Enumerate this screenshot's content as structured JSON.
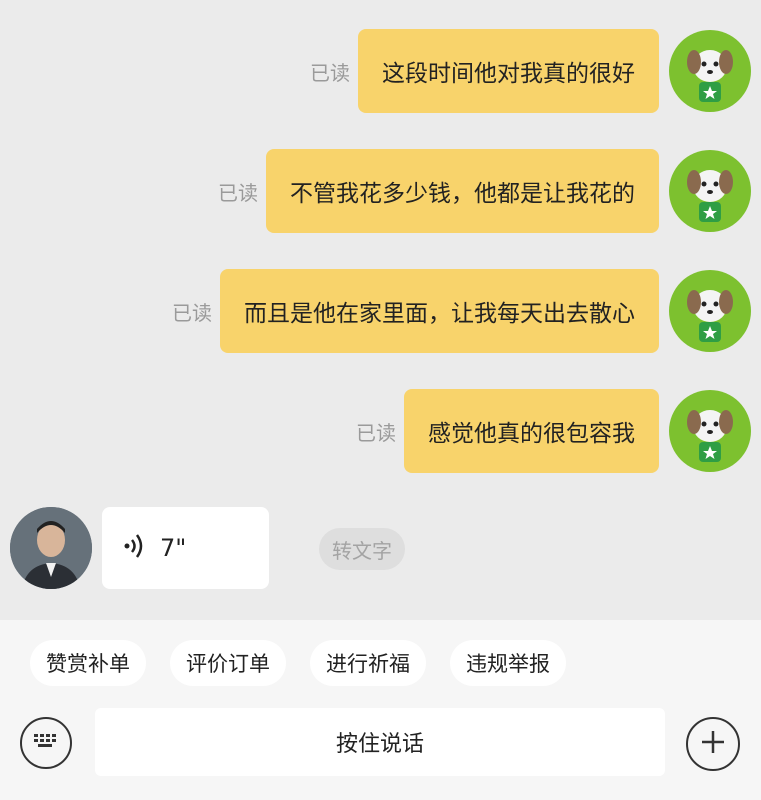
{
  "messages": [
    {
      "read": "已读",
      "text": "这段时间他对我真的很好"
    },
    {
      "read": "已读",
      "text": "不管我花多少钱，他都是让我花的"
    },
    {
      "read": "已读",
      "text": "而且是他在家里面，让我每天出去散心"
    },
    {
      "read": "已读",
      "text": "感觉他真的很包容我"
    }
  ],
  "voice": {
    "duration": "7\"",
    "convert_label": "转文字"
  },
  "quick_actions": [
    "赞赏补单",
    "评价订单",
    "进行祈福",
    "违规举报"
  ],
  "input": {
    "hold_to_talk": "按住说话"
  },
  "colors": {
    "bubble": "#f8d36b",
    "avatar_bg": "#7dc12f",
    "background": "#ebebeb"
  },
  "icons": {
    "my_avatar": "cartoon-dog-avatar",
    "other_avatar": "person-avatar",
    "voice": "sound-wave-icon",
    "keyboard": "keyboard-icon",
    "plus": "plus-icon"
  }
}
